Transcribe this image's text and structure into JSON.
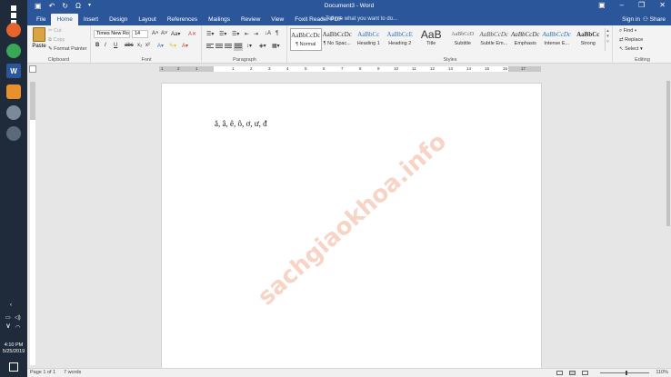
{
  "app": {
    "title": "Document3 - Word"
  },
  "taskbar": {
    "time": "4:10 PM",
    "date": "5/25/2019",
    "lang": "V"
  },
  "tabs": [
    {
      "label": "File"
    },
    {
      "label": "Home"
    },
    {
      "label": "Insert"
    },
    {
      "label": "Design"
    },
    {
      "label": "Layout"
    },
    {
      "label": "References"
    },
    {
      "label": "Mailings"
    },
    {
      "label": "Review"
    },
    {
      "label": "View"
    },
    {
      "label": "Foxit Reader PDF"
    }
  ],
  "tellme": "Tell me what you want to do...",
  "signin": "Sign in",
  "share": "Share",
  "clipboard": {
    "paste": "Paste",
    "cut": "Cut",
    "copy": "Copy",
    "format_painter": "Format Painter",
    "label": "Clipboard"
  },
  "font": {
    "name": "Times New Ro",
    "size": "14",
    "label": "Font"
  },
  "paragraph": {
    "label": "Paragraph"
  },
  "styles": {
    "label": "Styles",
    "items": [
      {
        "sample": "AaBbCcDc",
        "name": "¶ Normal"
      },
      {
        "sample": "AaBbCcDc",
        "name": "¶ No Spac..."
      },
      {
        "sample": "AaBbCc",
        "name": "Heading 1"
      },
      {
        "sample": "AaBbCcE",
        "name": "Heading 2"
      },
      {
        "sample": "AaB",
        "name": "Title"
      },
      {
        "sample": "AaBbCcD",
        "name": "Subtitle"
      },
      {
        "sample": "AaBbCcDc",
        "name": "Subtle Em..."
      },
      {
        "sample": "AaBbCcDc",
        "name": "Emphasis"
      },
      {
        "sample": "AaBbCcDc",
        "name": "Intense E..."
      },
      {
        "sample": "AaBbCc",
        "name": "Strong"
      }
    ]
  },
  "editing": {
    "find": "Find",
    "replace": "Replace",
    "select": "Select",
    "label": "Editing"
  },
  "ruler": {
    "ticks": [
      "1",
      "2",
      "1",
      "1",
      "2",
      "3",
      "4",
      "5",
      "6",
      "7",
      "8",
      "9",
      "10",
      "11",
      "12",
      "13",
      "14",
      "15",
      "16",
      "17"
    ]
  },
  "document": {
    "text": "ă, â, ê, ô, ơ, ư, đ",
    "watermark": "sachgiaokhoa.info"
  },
  "status": {
    "page": "Page 1 of 1",
    "words": "7 words",
    "zoom": "110%"
  }
}
